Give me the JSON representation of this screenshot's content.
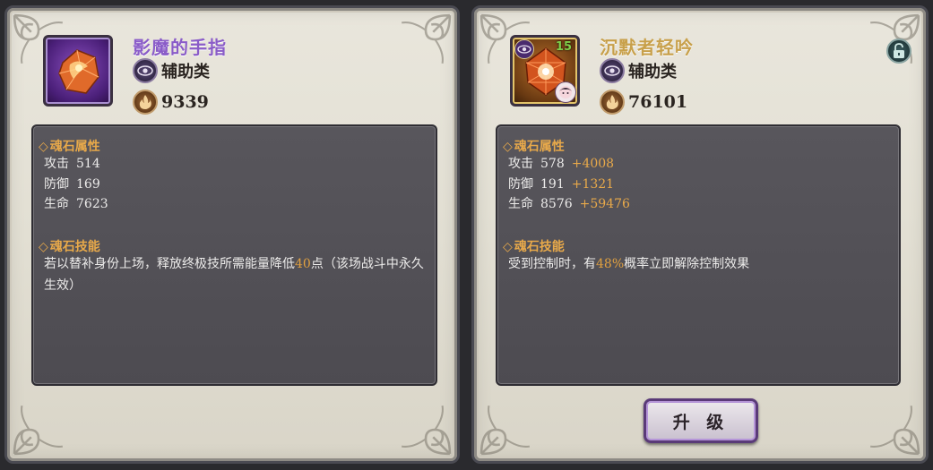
{
  "cards": {
    "left": {
      "name": "影魔的手指",
      "type_label": "辅助类",
      "power": "9339",
      "attributes_heading": "魂石属性",
      "stats": [
        {
          "label": "攻击",
          "value": "514"
        },
        {
          "label": "防御",
          "value": "169"
        },
        {
          "label": "生命",
          "value": "7623"
        }
      ],
      "skill_heading": "魂石技能",
      "skill_text_before": "若以替补身份上场，释放终极技所需能量降低",
      "skill_highlight": "40",
      "skill_text_after": "点（该场战斗中永久生效）"
    },
    "right": {
      "name": "沉默者轻吟",
      "level": "15",
      "type_label": "辅助类",
      "power": "76101",
      "attributes_heading": "魂石属性",
      "stats": [
        {
          "label": "攻击",
          "value": "578",
          "bonus": "+4008"
        },
        {
          "label": "防御",
          "value": "191",
          "bonus": "+1321"
        },
        {
          "label": "生命",
          "value": "8576",
          "bonus": "+59476"
        }
      ],
      "skill_heading": "魂石技能",
      "skill_text_before": "受到控制时，有",
      "skill_highlight": "48%",
      "skill_text_after": "概率立即解除控制效果",
      "upgrade_label": "升 级"
    }
  }
}
